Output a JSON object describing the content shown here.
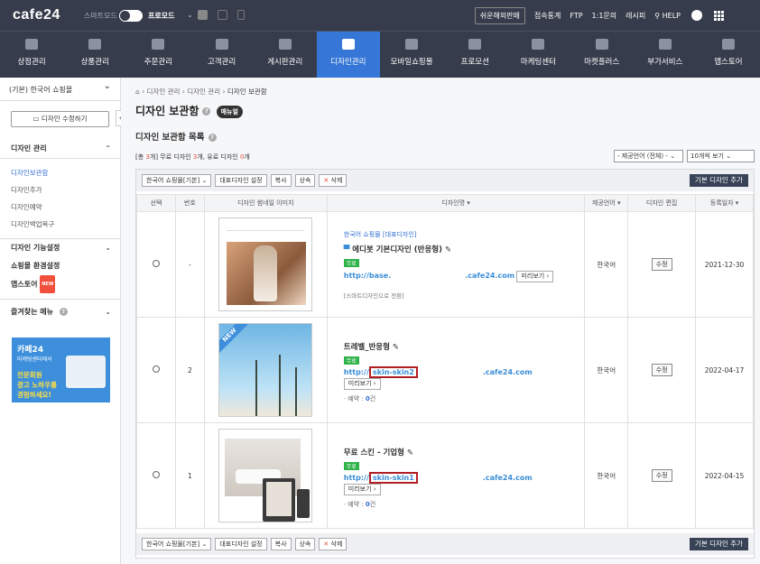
{
  "topbar": {
    "logo": "cafe24",
    "smartmode": "스마트모드",
    "promode": "프로모드",
    "links": [
      "쉬운해외판매",
      "접속통계",
      "FTP",
      "1:1문의",
      "레시피",
      "HELP"
    ]
  },
  "menu": [
    {
      "label": "상점관리",
      "icon": "store-icon"
    },
    {
      "label": "상품관리",
      "icon": "tshirt-icon"
    },
    {
      "label": "주문관리",
      "icon": "cart-icon"
    },
    {
      "label": "고객관리",
      "icon": "user-icon"
    },
    {
      "label": "게시판관리",
      "icon": "board-icon"
    },
    {
      "label": "디자인관리",
      "icon": "palette-icon",
      "active": true
    },
    {
      "label": "모바일쇼핑몰",
      "icon": "mobile-icon"
    },
    {
      "label": "프로모션",
      "icon": "star-icon"
    },
    {
      "label": "마케팅센터",
      "icon": "megaphone-icon"
    },
    {
      "label": "마켓플러스",
      "icon": "share-icon"
    },
    {
      "label": "부가서비스",
      "icon": "folder-icon"
    },
    {
      "label": "앱스토어",
      "icon": "apps-icon"
    }
  ],
  "sidebar": {
    "shop": "(기본) 한국어 쇼핑몰",
    "edit_button": "디자인 수정하기",
    "design_section": "디자인 관리",
    "design_links": [
      "디자인보관함",
      "디자인추가",
      "디자인예약",
      "디자인백업복구"
    ],
    "feature_section": "디자인 기능설정",
    "env_section": "쇼핑몰 환경설정",
    "appstore": "앱스토어",
    "appstore_badge": "NEW",
    "fav_section": "즐겨찾는 메뉴",
    "banner": {
      "line1": "카페24",
      "line2": "마케팅센터에서",
      "line3": "전문회원",
      "line4": "광고 노하우를",
      "line5": "경험하세요!"
    }
  },
  "main": {
    "breadcrumb": [
      "홈",
      "디자인 관리",
      "디자인 관리",
      "디자인 보관함"
    ],
    "title": "디자인 보관함",
    "manual": "매뉴얼",
    "list_title": "디자인 보관함 목록",
    "count": {
      "pre": "[총 ",
      "total": "3",
      "mid1": "개] 무료 디자인 ",
      "free": "3",
      "mid2": "개, 유료 디자인 ",
      "paid": "0",
      "post": "개"
    },
    "lang_filter": "- 제공언어 (전체) -",
    "page_size": "10개씩 보기",
    "shop_select": "한국어 쇼핑몰[기본]",
    "actions": {
      "set_default": "대표디자인 설정",
      "copy": "복사",
      "inherit": "상속",
      "delete": "삭제",
      "add": "기본 디자인 추가"
    },
    "columns": [
      "선택",
      "번호",
      "디자인 썸네일 이미지",
      "디자인명",
      "제공언어",
      "디자인 편집",
      "등록일자"
    ],
    "rows": [
      {
        "no": "-",
        "shop_link": "한국어 쇼핑몰 [대표디자인]",
        "name": "에디봇 기본디자인 (반응형)",
        "free": "무료",
        "url_a": "http://base.",
        "url_b": ".cafe24.com",
        "preview": "미리보기",
        "note": "[스마트디자인으로 전환]",
        "lang": "한국어",
        "edit": "수정",
        "date": "2021-12-30"
      },
      {
        "no": "2",
        "name": "트레벨_반응형",
        "free": "무료",
        "url_a": "http://",
        "url_hl": "skin-skin2",
        "url_b": ".cafe24.com",
        "preview": "미리보기",
        "res_label": "예약 : ",
        "res": "0",
        "res_unit": "건",
        "lang": "한국어",
        "edit": "수정",
        "date": "2022-04-17"
      },
      {
        "no": "1",
        "name": "무료 스킨 - 기업형",
        "free": "무료",
        "url_a": "http://",
        "url_hl": "skin-skin1",
        "url_b": ".cafe24.com",
        "preview": "미리보기",
        "res_label": "예약 : ",
        "res": "0",
        "res_unit": "건",
        "lang": "한국어",
        "edit": "수정",
        "date": "2022-04-15"
      }
    ]
  }
}
